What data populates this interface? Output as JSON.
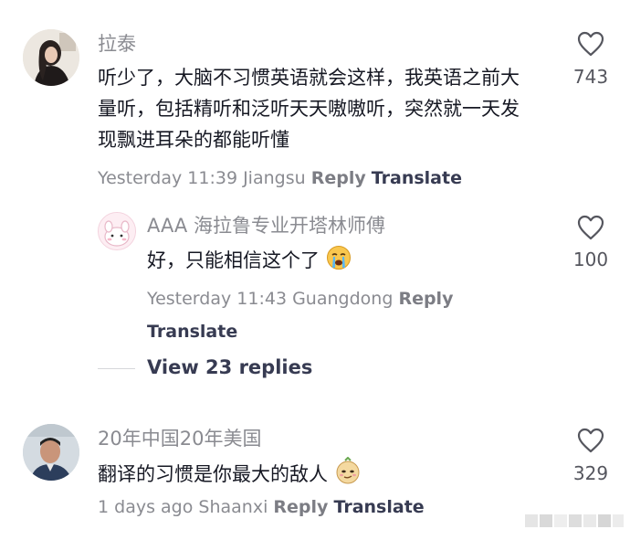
{
  "comments": [
    {
      "username": "拉泰",
      "text": "听少了，大脑不习惯英语就会这样，我英语之前大量听，包括精听和泛听天天嗷嗷听，突然就一天发现飘进耳朵的都能听懂",
      "time": "Yesterday 11:39",
      "location": "Jiangsu",
      "reply_label": "Reply",
      "translate_label": "Translate",
      "like_count": "743",
      "avatar_icon": "avatar-girl-photo",
      "like_icon": "heart-outline-icon"
    },
    {
      "username": "20年中国20年美国",
      "text": "翻译的习惯是你最大的敌人",
      "time": "1 days ago",
      "location": "Shaanxi",
      "reply_label": "Reply",
      "translate_label": "Translate",
      "like_count": "329",
      "avatar_icon": "avatar-man-photo",
      "like_icon": "heart-outline-icon"
    }
  ],
  "reply": {
    "username": "AAA 海拉鲁专业开塔林师傅",
    "text": "好，只能相信这个了",
    "time": "Yesterday 11:43",
    "location": "Guangdong",
    "reply_label": "Reply",
    "translate_label": "Translate",
    "like_count": "100",
    "avatar_icon": "avatar-pink-cartoon"
  },
  "view_replies": "View 23 replies",
  "colors": {
    "username": "#8a8b91",
    "body_text": "#161823",
    "meta_text": "#8a8b91",
    "translate": "#373b52",
    "divider": "#d6d7da"
  }
}
